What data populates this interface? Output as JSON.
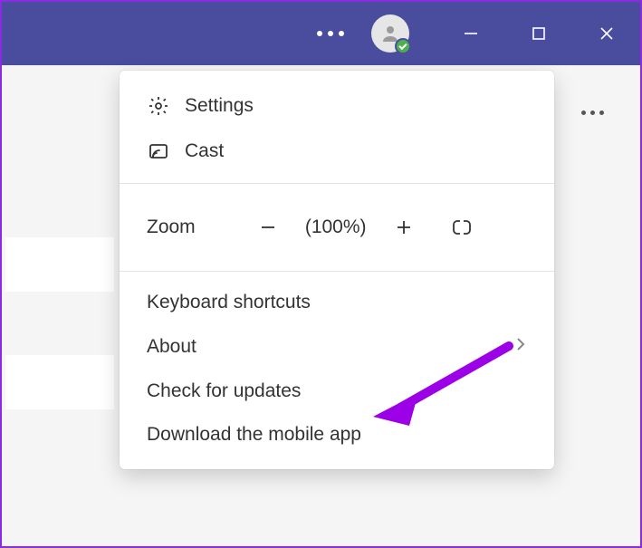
{
  "titlebar": {
    "more_label": "More",
    "avatar_label": "Profile",
    "presence": "available"
  },
  "window_controls": {
    "minimize": "Minimize",
    "maximize": "Maximize",
    "close": "Close"
  },
  "menu": {
    "settings": "Settings",
    "cast": "Cast",
    "zoom_label": "Zoom",
    "zoom_value": "(100%)",
    "keyboard_shortcuts": "Keyboard shortcuts",
    "about": "About",
    "check_updates": "Check for updates",
    "download_mobile": "Download the mobile app"
  },
  "annotation": {
    "arrow_color": "#9b00e6",
    "target": "check_updates"
  }
}
